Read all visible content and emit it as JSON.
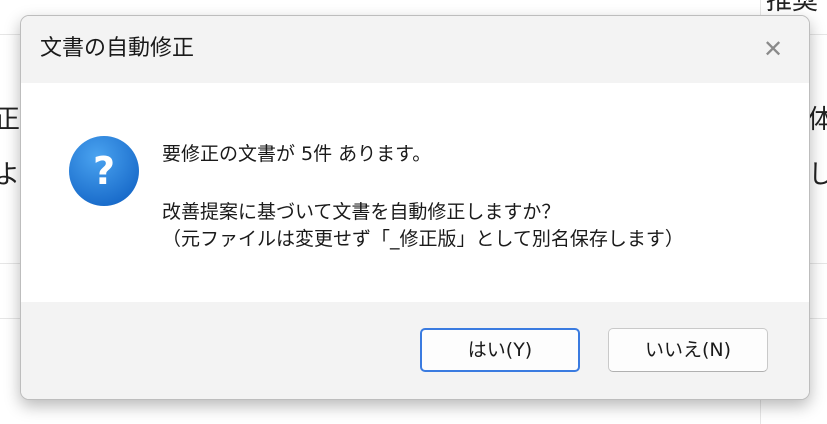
{
  "background": {
    "fragments": [
      {
        "text": "推奨"
      },
      {
        "text": "正"
      },
      {
        "text": "よ"
      },
      {
        "text": "体"
      },
      {
        "text": "し"
      }
    ]
  },
  "dialog": {
    "title": "文書の自動修正",
    "close_symbol": "✕",
    "icon": "question-icon",
    "accent_color": "#1e7fd8",
    "message": {
      "line1": "要修正の文書が 5件 あります。",
      "line2": "改善提案に基づいて文書を自動修正しますか？",
      "line3": "（元ファイルは変更せず「_修正版」として別名保存します）"
    },
    "buttons": {
      "yes": "はい(Y)",
      "no": "いいえ(N)"
    }
  }
}
